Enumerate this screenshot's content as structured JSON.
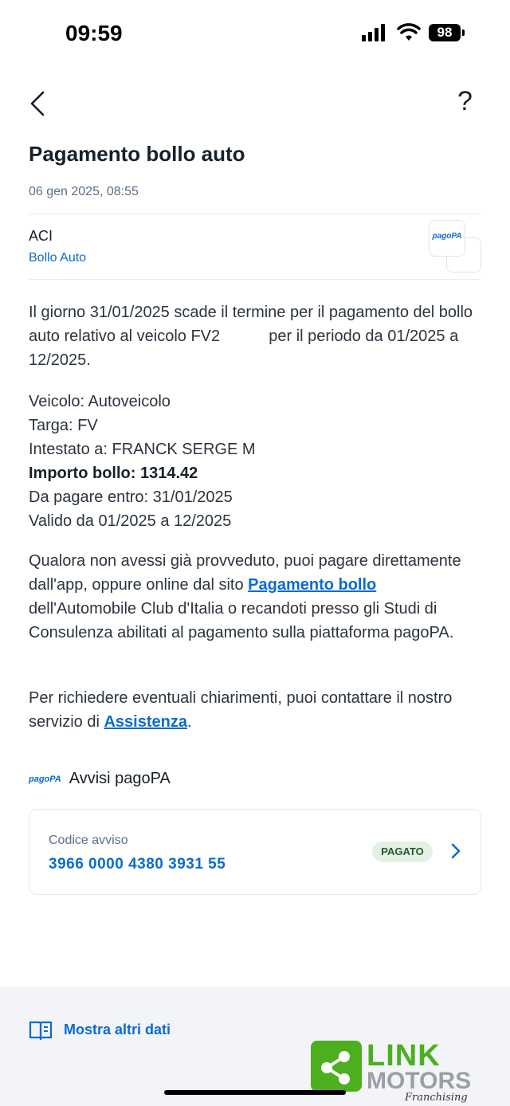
{
  "status": {
    "time": "09:59",
    "battery": "98"
  },
  "header": {
    "title": "Pagamento bollo auto",
    "date": "06 gen 2025, 08:55"
  },
  "sender": {
    "name": "ACI",
    "service": "Bollo Auto",
    "logo_text": "pagoPA"
  },
  "message": {
    "p1": "Il giorno 31/01/2025 scade il termine per il pagamento del bollo auto relativo al veicolo FV2           per il periodo da 01/2025 a 12/2025.",
    "veicolo": "Veicolo: Autoveicolo",
    "targa": "Targa: FV",
    "intestato": "Intestato a: FRANCK SERGE M",
    "importo": "Importo bollo: 1314.42",
    "scadenza": "Da pagare entro: 31/01/2025",
    "validita": "Valido da 01/2025 a 12/2025",
    "p3_before": "Qualora non avessi già provveduto, puoi pagare direttamente dall'app, oppure online dal sito ",
    "p3_link": "Pagamento bollo",
    "p3_after": " dell'Automobile Club d'Italia o recandoti presso gli Studi di Consulenza abilitati al pagamento sulla piattaforma pagoPA.",
    "p4_before": "Per richiedere eventuali chiarimenti, puoi contattare il nostro servizio di ",
    "p4_link": "Assistenza",
    "p4_after": "."
  },
  "notices": {
    "icon_text": "pagoPA",
    "title": "Avvisi pagoPA",
    "card": {
      "label": "Codice avviso",
      "code": "3966 0000 4380 3931 55",
      "status": "PAGATO"
    }
  },
  "footer": {
    "more_label": "Mostra altri dati"
  },
  "watermark": {
    "line1": "LINK",
    "line2": "MOTORS",
    "line3": "Franchising"
  },
  "colors": {
    "accent": "#0b6bcf",
    "badge_bg": "#e3f2e4",
    "watermark_green": "#4caf1e"
  }
}
